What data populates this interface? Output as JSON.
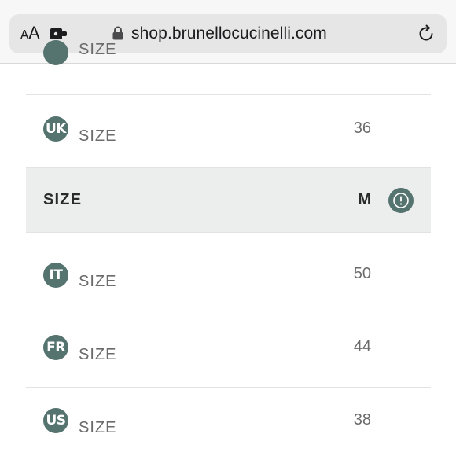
{
  "browser": {
    "text_size_small": "A",
    "text_size_big": "A",
    "url": "shop.brunellocucinelli.com"
  },
  "size_rows": {
    "partial_label": "SIZE",
    "uk": {
      "badge": "UK",
      "label": "SIZE",
      "value": "36"
    },
    "selected": {
      "label": "SIZE",
      "value": "M"
    },
    "it": {
      "badge": "IT",
      "label": "SIZE",
      "value": "50"
    },
    "fr": {
      "badge": "FR",
      "label": "SIZE",
      "value": "44"
    },
    "us": {
      "badge": "US",
      "label": "SIZE",
      "value": "38"
    }
  },
  "colors": {
    "badge": "#55736f",
    "selected_bg": "#eceeed"
  },
  "icons": [
    "text-size-icon",
    "extension-icon",
    "lock-icon",
    "reload-icon",
    "info-icon"
  ]
}
